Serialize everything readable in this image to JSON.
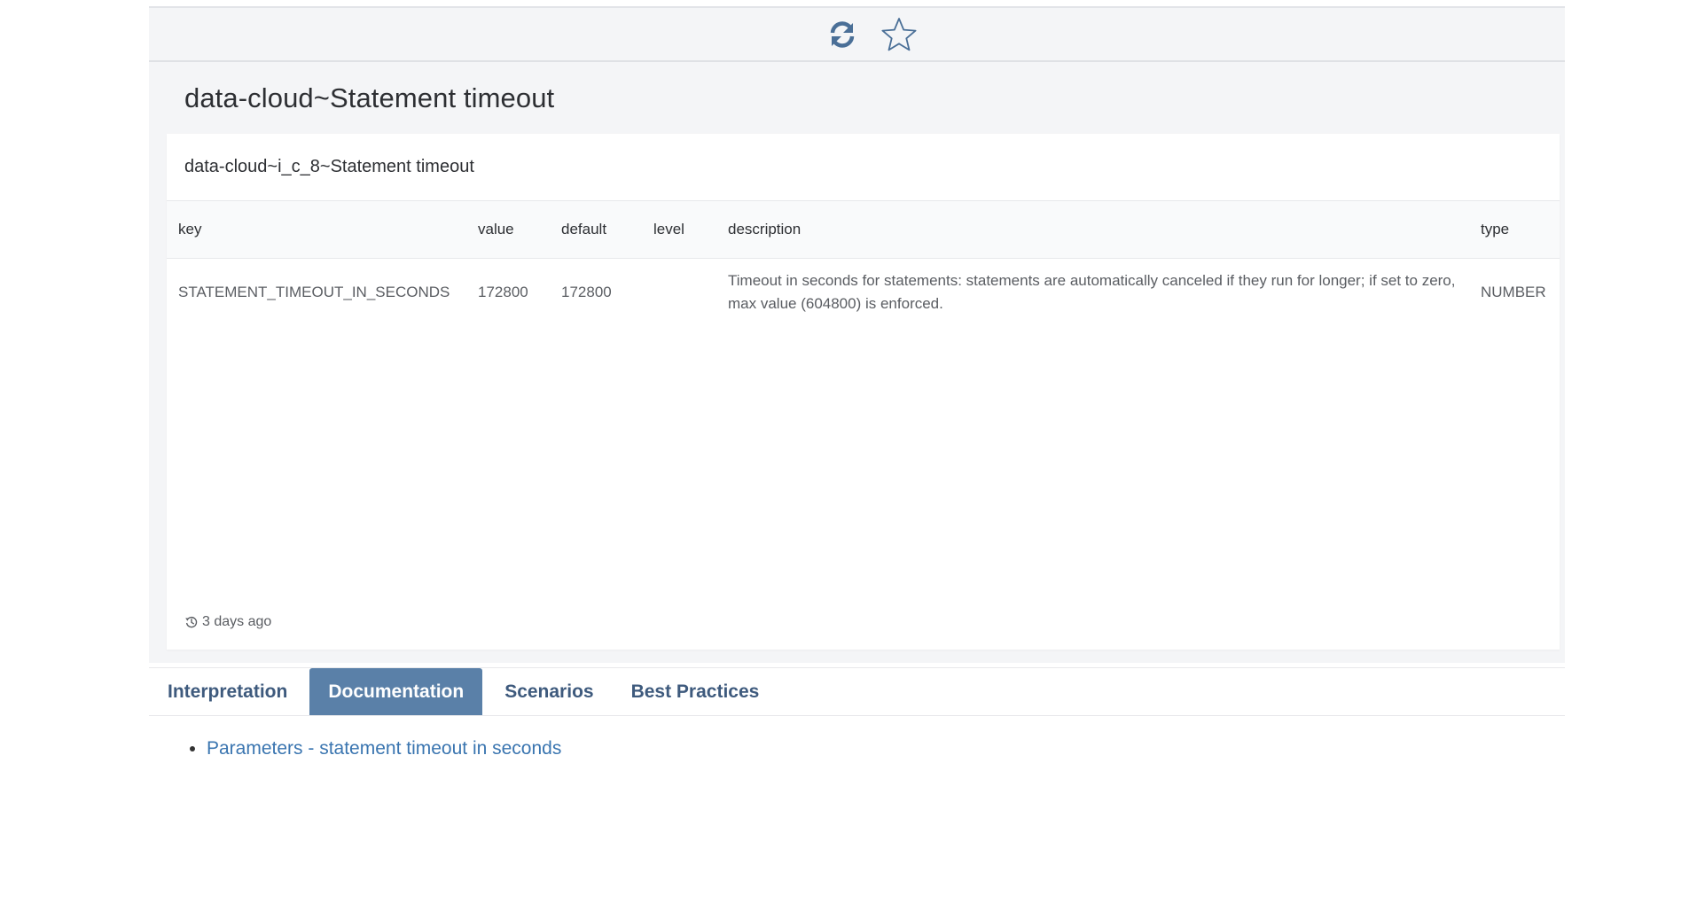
{
  "toolbar": {
    "refresh_icon": "refresh-icon",
    "star_icon": "star-icon"
  },
  "page": {
    "title": "data-cloud~Statement timeout"
  },
  "card": {
    "header": "data-cloud~i_c_8~Statement timeout",
    "columns": {
      "key": "key",
      "value": "value",
      "default": "default",
      "level": "level",
      "description": "description",
      "type": "type"
    },
    "rows": [
      {
        "key": "STATEMENT_TIMEOUT_IN_SECONDS",
        "value": "172800",
        "default": "172800",
        "level": "",
        "description": "Timeout in seconds for statements: statements are automatically canceled if they run for longer; if set to zero, max value (604800) is enforced.",
        "type": "NUMBER"
      }
    ],
    "updated": "3 days ago"
  },
  "tabs": [
    {
      "label": "Interpretation",
      "active": false
    },
    {
      "label": "Documentation",
      "active": true
    },
    {
      "label": "Scenarios",
      "active": false
    },
    {
      "label": "Best Practices",
      "active": false
    }
  ],
  "docs": {
    "links": [
      {
        "label": "Parameters - statement timeout in seconds"
      }
    ]
  },
  "colors": {
    "accent": "#5a80a8",
    "tab_text": "#3e5a7d",
    "link": "#3a75b0",
    "icon": "#4a6f97"
  }
}
